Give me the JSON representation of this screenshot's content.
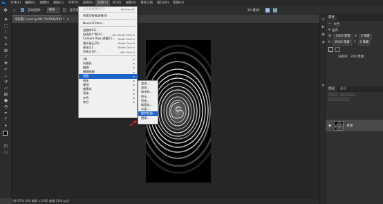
{
  "menubar": {
    "logo": "Ps",
    "items": [
      "文件(F)",
      "编辑(E)",
      "图像(I)",
      "图层(L)",
      "文字(Y)",
      "选择(S)",
      "滤镜(T)",
      "3D(D)",
      "视图(V)",
      "增效工具",
      "窗口(W)",
      "帮助(H)"
    ],
    "active_index": 6
  },
  "options_bar": {
    "auto_select_label": "自动选择：",
    "auto_select_value": "图层",
    "show_transform_label": "显示变换控件",
    "mode_label": "3D 模式："
  },
  "document_tab": {
    "title": "未标题-1.psd @ 66.7%(RGB/8#) *",
    "close": "×"
  },
  "filter_menu": {
    "items": [
      {
        "label": "上次滤镜操作(F)",
        "shortcut": "Alt+Ctrl+F",
        "disabled": true
      },
      {
        "separator": true
      },
      {
        "label": "转换为智能滤镜(S)"
      },
      {
        "separator": true
      },
      {
        "label": "Neural Filters..."
      },
      {
        "separator": true
      },
      {
        "label": "滤镜库(G)..."
      },
      {
        "label": "自适应广角(A)...",
        "shortcut": "Alt+Shift+Ctrl+A"
      },
      {
        "label": "Camera Raw 滤镜(C)...",
        "shortcut": "Shift+Ctrl+A"
      },
      {
        "label": "镜头校正(R)...",
        "shortcut": "Shift+Ctrl+R"
      },
      {
        "label": "液化(L)...",
        "shortcut": "Shift+Ctrl+X"
      },
      {
        "label": "消失点(V)...",
        "shortcut": "Alt+Ctrl+V"
      },
      {
        "separator": true
      },
      {
        "label": "3D",
        "submenu": true
      },
      {
        "label": "风格化",
        "submenu": true
      },
      {
        "label": "模糊",
        "submenu": true
      },
      {
        "label": "模糊画廊",
        "submenu": true
      },
      {
        "label": "扭曲",
        "submenu": true,
        "highlight": true
      },
      {
        "label": "锐化",
        "submenu": true
      },
      {
        "label": "视频",
        "submenu": true
      },
      {
        "label": "像素化",
        "submenu": true
      },
      {
        "label": "渲染",
        "submenu": true
      },
      {
        "label": "杂色",
        "submenu": true
      },
      {
        "label": "其它",
        "submenu": true
      }
    ]
  },
  "distort_submenu": {
    "items": [
      {
        "label": "波浪..."
      },
      {
        "label": "波纹..."
      },
      {
        "label": "极坐标..."
      },
      {
        "label": "挤压..."
      },
      {
        "label": "切变..."
      },
      {
        "label": "球面化..."
      },
      {
        "label": "水波..."
      },
      {
        "label": "旋转扭曲...",
        "highlight": true
      },
      {
        "label": "置换..."
      }
    ]
  },
  "properties_panel": {
    "tab_active": "属性",
    "doc_label": "文档",
    "canvas_label": "画布",
    "width_label": "W",
    "width_value": "2400 像素",
    "height_label": "H",
    "height_value": "2000 像素",
    "x_label": "X",
    "x_value": "0 像素",
    "y_label": "Y",
    "y_value": "0 像素",
    "resolution": "分辨率：300 像素/"
  },
  "layers_panel": {
    "tab_active": "图层",
    "tab_other": "通道",
    "layer_name": "背景"
  },
  "status_bar": {
    "text": "66.67%  500 像素 x 2000 像素 (300 ppi)"
  },
  "colors": {
    "menu_highlight": "#1e64c8",
    "canvas": "#000000"
  }
}
